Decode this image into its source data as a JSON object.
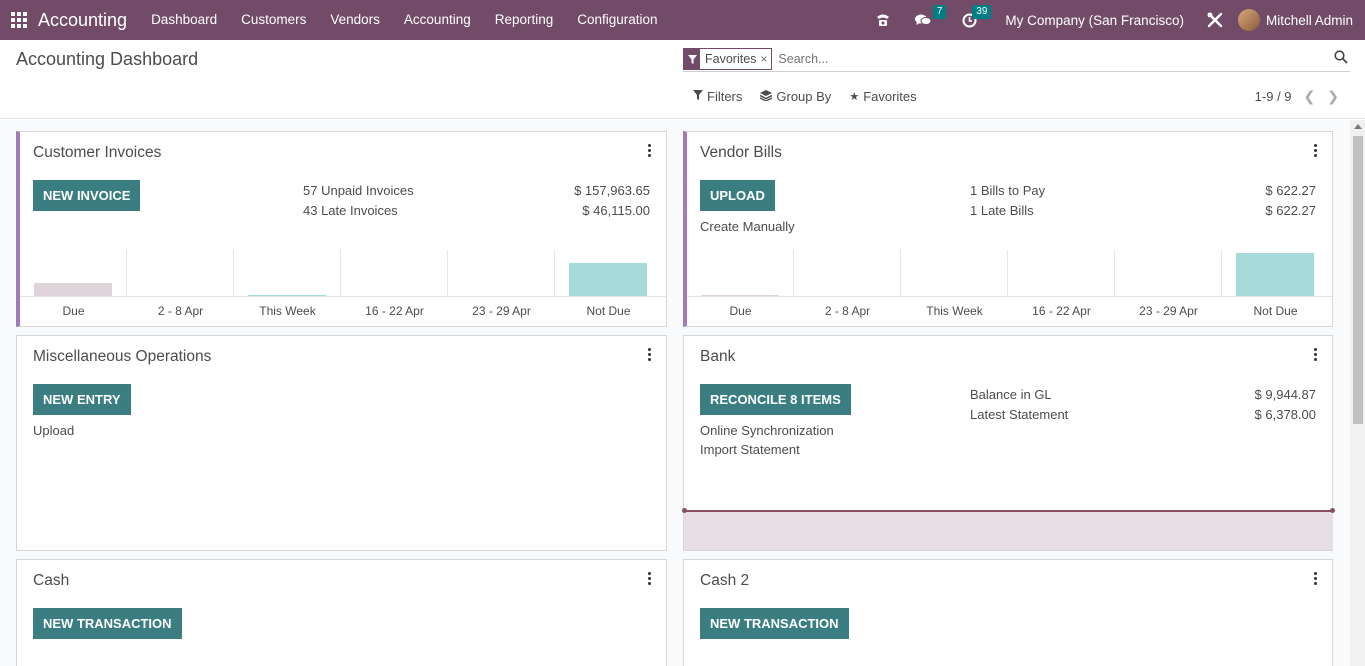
{
  "navbar": {
    "app_name": "Accounting",
    "menu": [
      "Dashboard",
      "Customers",
      "Vendors",
      "Accounting",
      "Reporting",
      "Configuration"
    ],
    "messages_count": "7",
    "activities_count": "39",
    "company": "My Company (San Francisco)",
    "user": "Mitchell Admin"
  },
  "control_panel": {
    "title": "Accounting Dashboard",
    "facet_label": "Favorites",
    "facet_close": "×",
    "search_placeholder": "Search...",
    "filters_label": "Filters",
    "group_by_label": "Group By",
    "favorites_label": "Favorites",
    "pager": "1-9 / 9"
  },
  "cards": {
    "customer_invoices": {
      "title": "Customer Invoices",
      "button": "NEW INVOICE",
      "stats": [
        {
          "label": "57 Unpaid Invoices",
          "value": "$ 157,963.65"
        },
        {
          "label": "43 Late Invoices",
          "value": "$ 46,115.00"
        }
      ],
      "chart_labels": [
        "Due",
        "2 - 8 Apr",
        "This Week",
        "16 - 22 Apr",
        "23 - 29 Apr",
        "Not Due"
      ]
    },
    "vendor_bills": {
      "title": "Vendor Bills",
      "button": "UPLOAD",
      "link": "Create Manually",
      "stats": [
        {
          "label": "1 Bills to Pay",
          "value": "$ 622.27"
        },
        {
          "label": "1 Late Bills",
          "value": "$ 622.27"
        }
      ],
      "chart_labels": [
        "Due",
        "2 - 8 Apr",
        "This Week",
        "16 - 22 Apr",
        "23 - 29 Apr",
        "Not Due"
      ]
    },
    "misc": {
      "title": "Miscellaneous Operations",
      "button": "NEW ENTRY",
      "link": "Upload"
    },
    "bank": {
      "title": "Bank",
      "button": "RECONCILE 8 ITEMS",
      "links": [
        "Online Synchronization",
        "Import Statement"
      ],
      "stats": [
        {
          "label": "Balance in GL",
          "value": "$ 9,944.87"
        },
        {
          "label": "Latest Statement",
          "value": "$ 6,378.00"
        }
      ]
    },
    "cash": {
      "title": "Cash",
      "button": "NEW TRANSACTION"
    },
    "cash2": {
      "title": "Cash 2",
      "button": "NEW TRANSACTION"
    }
  },
  "colors": {
    "brand": "#714b67",
    "button": "#3b7e82",
    "accent_border": "#a27ab8",
    "bar_past_due": "#e0d3d9",
    "bar_not_due": "#a6dbd9"
  }
}
